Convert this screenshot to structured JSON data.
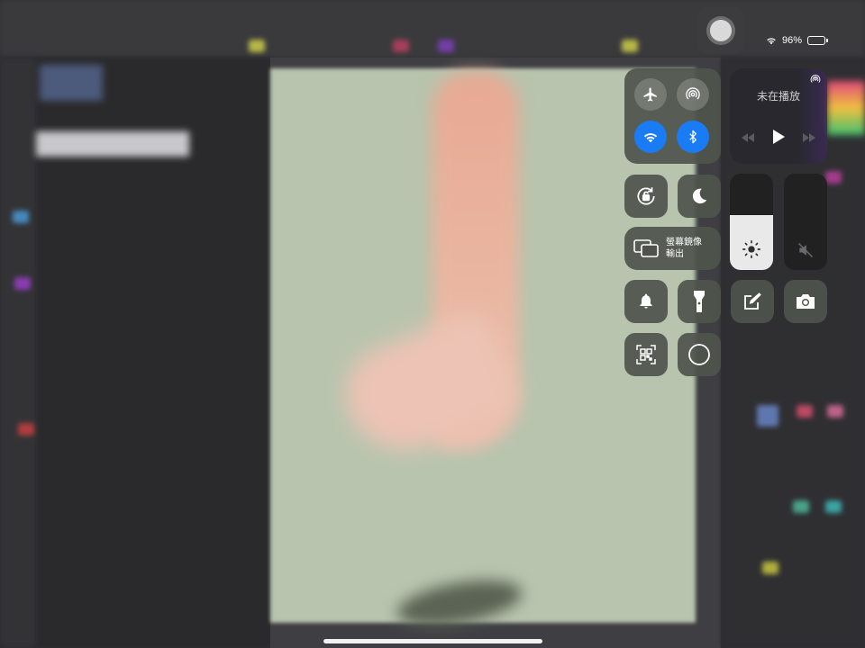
{
  "status_bar": {
    "wifi_icon": "wifi-icon",
    "battery_percent": "96%",
    "battery_icon": "battery-icon"
  },
  "assistive_touch": {
    "icon": "assistive-touch-icon"
  },
  "control_center": {
    "connectivity": {
      "airplane_mode": {
        "icon": "airplane-icon",
        "state": "off"
      },
      "airdrop": {
        "icon": "airdrop-icon",
        "state": "off"
      },
      "wifi": {
        "icon": "wifi-icon",
        "state": "on",
        "color": "#1a7cf5"
      },
      "bluetooth": {
        "icon": "bluetooth-icon",
        "state": "on",
        "color": "#1a7cf5"
      }
    },
    "media": {
      "status_text": "未在播放",
      "airplay_icon": "airplay-icon",
      "prev_icon": "rewind-icon",
      "play_icon": "play-icon",
      "next_icon": "fast-forward-icon"
    },
    "orientation_lock": {
      "icon": "rotation-lock-icon"
    },
    "do_not_disturb": {
      "icon": "moon-icon"
    },
    "screen_mirroring": {
      "icon": "screen-mirroring-icon",
      "label_line1": "螢幕鏡像",
      "label_line2": "輸出"
    },
    "brightness": {
      "icon": "sun-icon",
      "level": 0.57
    },
    "volume": {
      "icon": "speaker-muted-icon",
      "level": 0.0
    },
    "silent": {
      "icon": "bell-icon"
    },
    "flashlight": {
      "icon": "flashlight-icon"
    },
    "notes": {
      "icon": "note-pencil-icon"
    },
    "camera": {
      "icon": "camera-icon"
    },
    "qr_scanner": {
      "icon": "qr-code-icon"
    },
    "screen_recording": {
      "icon": "record-icon"
    }
  },
  "home_indicator": {
    "icon": "home-indicator"
  }
}
